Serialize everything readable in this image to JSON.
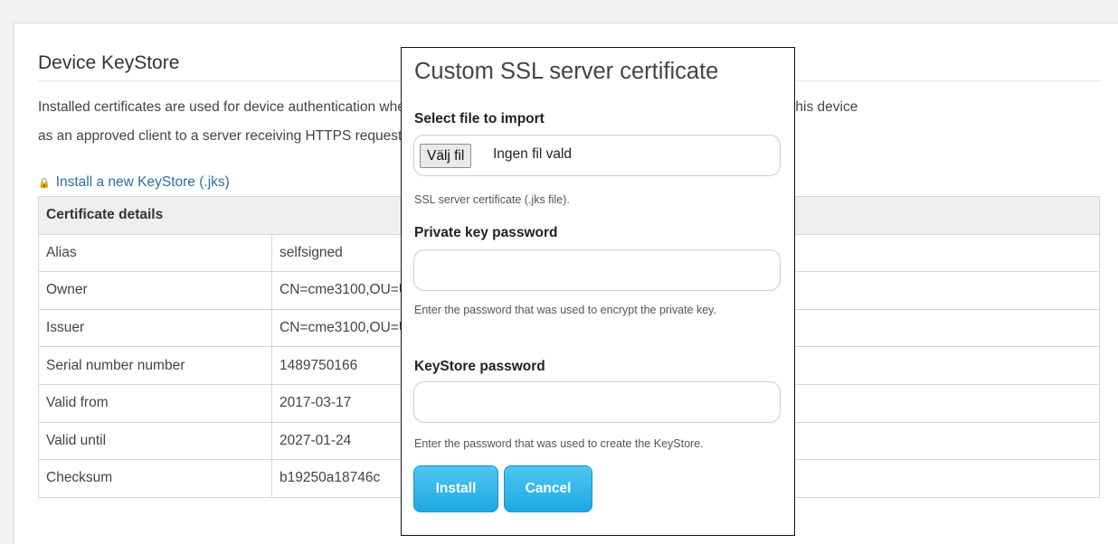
{
  "page": {
    "title": "Device KeyStore",
    "description_line1": "Installed certificates are used for device authentication when connecting to a server over HTTPS/FTPS or to authenticate this device",
    "description_line2": "as an approved client to a server receiving HTTPS requests. The default KeyStore contains a self-signed certificate.",
    "install_link": "Install a new KeyStore (.jks)"
  },
  "certificate": {
    "header": "Certificate details",
    "rows": [
      {
        "key": "Alias",
        "value": "selfsigned"
      },
      {
        "key": "Owner",
        "value": "CN=cme3100,OU=Unknown,O=Unknown,L=Unknown,ST=Unknown,C=Unknown"
      },
      {
        "key": "Issuer",
        "value": "CN=cme3100,OU=Unknown,O=Unknown,L=Unknown,ST=Unknown,C=Unknown"
      },
      {
        "key": "Serial number number",
        "value": "1489750166"
      },
      {
        "key": "Valid from",
        "value": "2017-03-17"
      },
      {
        "key": "Valid until",
        "value": "2027-01-24"
      },
      {
        "key": "Checksum",
        "value": "b19250a18746c"
      }
    ]
  },
  "modal": {
    "title": "Custom SSL server certificate",
    "file_label": "Select file to import",
    "file_button": "Välj fil",
    "file_status": "Ingen fil vald",
    "file_hint": "SSL server certificate (.jks file).",
    "private_key_label": "Private key password",
    "private_key_value": "",
    "private_key_hint": "Enter the password that was used to encrypt the private key.",
    "keystore_label": "KeyStore password",
    "keystore_value": "",
    "keystore_hint": "Enter the password that was used to create the KeyStore.",
    "install_button": "Install",
    "cancel_button": "Cancel"
  },
  "icons": {
    "install_link": "lock-icon"
  },
  "colors": {
    "accent": "#1da9e3",
    "link": "#2a6da8"
  }
}
